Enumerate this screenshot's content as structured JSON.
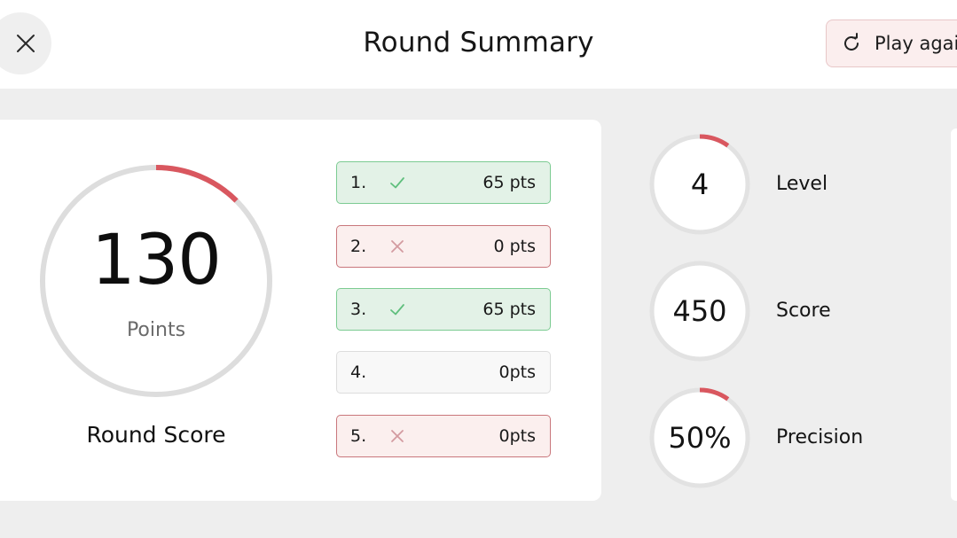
{
  "header": {
    "title": "Round Summary",
    "close_icon": "close-icon",
    "play_again": {
      "label": "Play again",
      "icon": "refresh-icon"
    }
  },
  "round": {
    "value": "130",
    "unit": "Points",
    "label": "Round Score",
    "progress_fraction": 0.125,
    "accent_color": "#d9575f",
    "track_color": "#dddddd"
  },
  "questions": [
    {
      "index": "1.",
      "status": "correct",
      "icon": "check-icon",
      "points": "65 pts"
    },
    {
      "index": "2.",
      "status": "wrong",
      "icon": "cross-icon",
      "points": "0 pts"
    },
    {
      "index": "3.",
      "status": "correct",
      "icon": "check-icon",
      "points": "65 pts"
    },
    {
      "index": "4.",
      "status": "unanswered",
      "icon": "",
      "points": "0pts"
    },
    {
      "index": "5.",
      "status": "wrong",
      "icon": "cross-icon",
      "points": "0pts"
    }
  ],
  "stats": [
    {
      "value": "4",
      "label": "Level",
      "progress_fraction": 0.1
    },
    {
      "value": "450",
      "label": "Score",
      "progress_fraction": 0
    },
    {
      "value": "50%",
      "label": "Precision",
      "progress_fraction": 0.1
    }
  ],
  "colors": {
    "correct_border": "#7ccb92",
    "correct_bg": "#e3f2e7",
    "wrong_border": "#c9777c",
    "wrong_bg": "#fbefee",
    "check": "#5fbf7d",
    "cross": "#d39aa0"
  }
}
